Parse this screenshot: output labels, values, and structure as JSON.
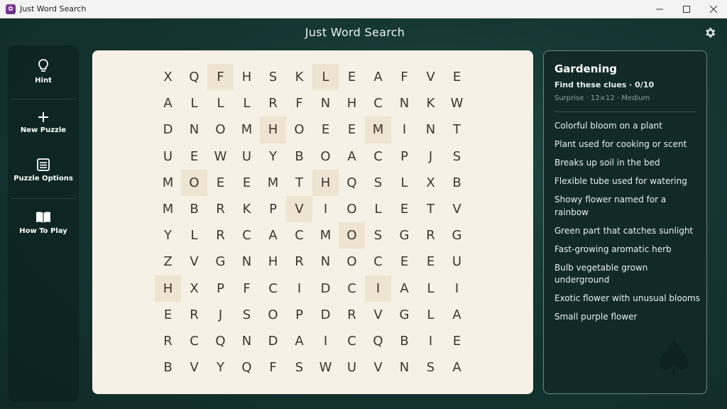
{
  "window": {
    "title": "Just Word Search",
    "icon": "app-icon",
    "controls": [
      "minimize-icon",
      "maximize-icon",
      "close-icon"
    ]
  },
  "app": {
    "title": "Just Word Search",
    "settings_icon": "gear-icon"
  },
  "sidebar": {
    "items": [
      {
        "label": "Hint",
        "icon": "lightbulb-icon"
      },
      {
        "label": "New Puzzle",
        "icon": "plus-icon"
      },
      {
        "label": "Puzzle Options",
        "icon": "list-icon"
      },
      {
        "label": "How To Play",
        "icon": "book-icon"
      }
    ]
  },
  "grid": {
    "rows": [
      [
        "X",
        "Q",
        "F",
        "H",
        "S",
        "K",
        "L",
        "E",
        "A",
        "F",
        "V",
        "E"
      ],
      [
        "A",
        "L",
        "L",
        "L",
        "R",
        "F",
        "N",
        "H",
        "C",
        "N",
        "K",
        "W"
      ],
      [
        "D",
        "N",
        "O",
        "M",
        "H",
        "O",
        "E",
        "E",
        "M",
        "I",
        "N",
        "T"
      ],
      [
        "U",
        "E",
        "W",
        "U",
        "Y",
        "B",
        "O",
        "A",
        "C",
        "P",
        "J",
        "S"
      ],
      [
        "M",
        "O",
        "E",
        "E",
        "M",
        "T",
        "H",
        "Q",
        "S",
        "L",
        "X",
        "B"
      ],
      [
        "M",
        "B",
        "R",
        "K",
        "P",
        "V",
        "I",
        "O",
        "L",
        "E",
        "T",
        "V"
      ],
      [
        "Y",
        "L",
        "R",
        "C",
        "A",
        "C",
        "M",
        "O",
        "S",
        "G",
        "R",
        "G"
      ],
      [
        "Z",
        "V",
        "G",
        "N",
        "H",
        "R",
        "N",
        "O",
        "C",
        "E",
        "E",
        "U"
      ],
      [
        "H",
        "X",
        "P",
        "F",
        "C",
        "I",
        "D",
        "C",
        "I",
        "A",
        "L",
        "I"
      ],
      [
        "E",
        "R",
        "J",
        "S",
        "O",
        "P",
        "D",
        "R",
        "V",
        "G",
        "L",
        "A"
      ],
      [
        "R",
        "C",
        "Q",
        "N",
        "D",
        "A",
        "I",
        "C",
        "Q",
        "B",
        "I",
        "E"
      ],
      [
        "B",
        "V",
        "Y",
        "Q",
        "F",
        "S",
        "W",
        "U",
        "V",
        "N",
        "S",
        "A"
      ]
    ],
    "highlighted": [
      [
        0,
        2
      ],
      [
        0,
        6
      ],
      [
        2,
        4
      ],
      [
        2,
        8
      ],
      [
        4,
        1
      ],
      [
        4,
        6
      ],
      [
        5,
        5
      ],
      [
        6,
        7
      ],
      [
        8,
        0
      ],
      [
        8,
        8
      ]
    ],
    "highlight_color": "#ede4d2"
  },
  "clues": {
    "title": "Gardening",
    "find_text": "Find these clues · 0/10",
    "meta": "Surprise · 12×12 · Medium",
    "items": [
      "Colorful bloom on a plant",
      "Plant used for cooking or scent",
      "Breaks up soil in the bed",
      "Flexible tube used for watering",
      "Showy flower named for a rainbow",
      "Green part that catches sunlight",
      "Fast-growing aromatic herb",
      "Bulb vegetable grown underground",
      "Exotic flower with unusual blooms",
      "Small purple flower"
    ]
  },
  "colors": {
    "background": "#153632",
    "board": "#f6f1e6",
    "panel": "#112a28",
    "letter": "#3b3630"
  }
}
